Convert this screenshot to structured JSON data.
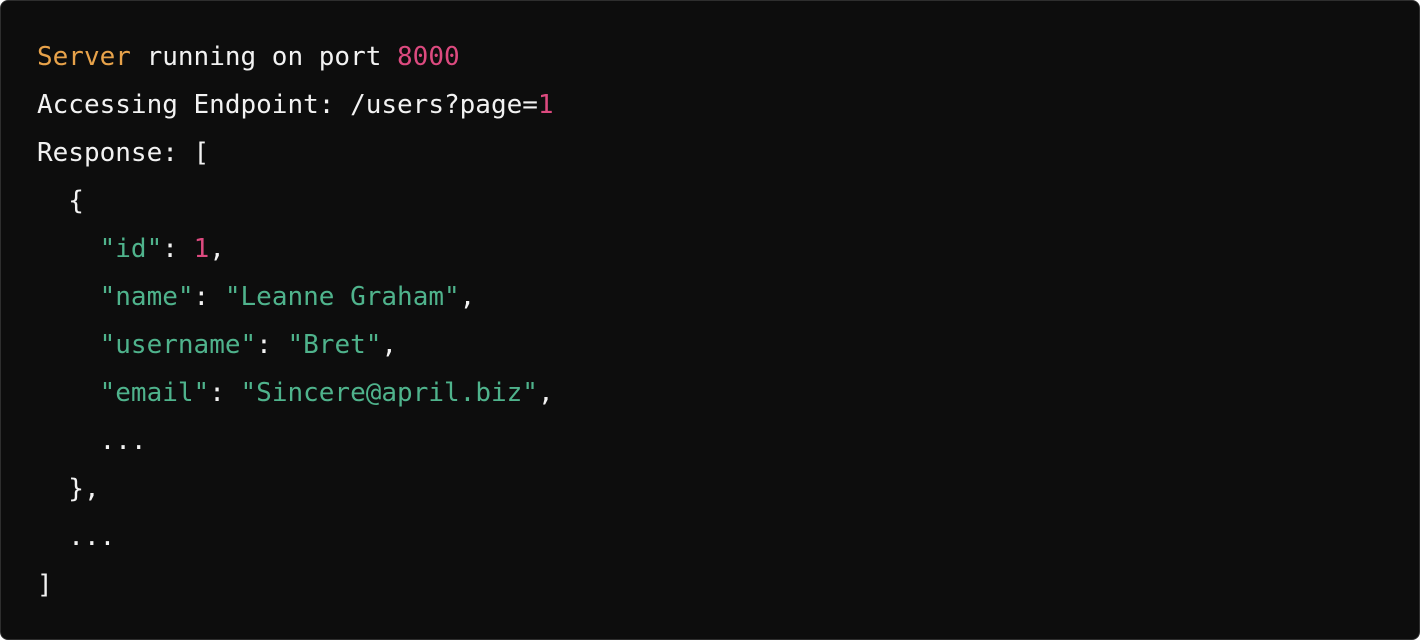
{
  "terminal": {
    "line1": {
      "keyword": "Server",
      "text": " running on port ",
      "port": "8000"
    },
    "line2": {
      "text": "Accessing Endpoint: /users?page=",
      "page": "1"
    },
    "line3": "Response: [",
    "line4": "  {",
    "line5": {
      "indent": "    ",
      "key": "\"id\"",
      "sep": ": ",
      "value": "1",
      "comma": ","
    },
    "line6": {
      "indent": "    ",
      "key": "\"name\"",
      "sep": ": ",
      "value": "\"Leanne Graham\"",
      "comma": ","
    },
    "line7": {
      "indent": "    ",
      "key": "\"username\"",
      "sep": ": ",
      "value": "\"Bret\"",
      "comma": ","
    },
    "line8": {
      "indent": "    ",
      "key": "\"email\"",
      "sep": ": ",
      "value": "\"Sincere@april.biz\"",
      "comma": ","
    },
    "line9": "    ...",
    "line10": "  },",
    "line11": "  ...",
    "line12": "]"
  },
  "colors": {
    "background": "#0d0d0d",
    "text": "#f2f2f2",
    "keyword": "#e7a24a",
    "number": "#dc4a7f",
    "string": "#4fb38c"
  }
}
